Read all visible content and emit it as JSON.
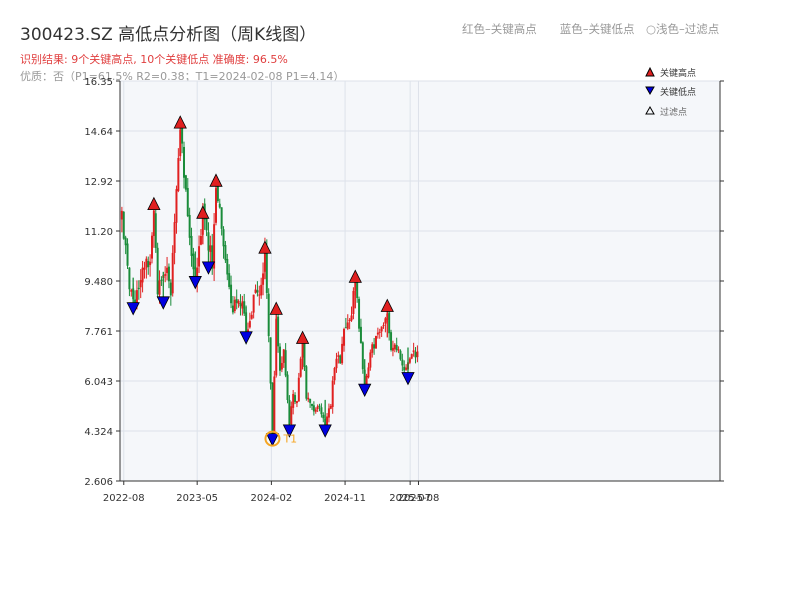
{
  "header": {
    "title": "300423.SZ 高低点分析图（周K线图）",
    "subtitle": "红色–关键高点　　蓝色–关键低点　○浅色–过滤点",
    "stats": "识别结果: 9个关键高点, 10个关键低点  准确度: 96.5%",
    "quality": "优质：否（P1=61.5%  R2=0.38；T1=2024-02-08 P1=4.14）"
  },
  "colors": {
    "up": "#e02020",
    "down": "#1a8c3a",
    "high_marker": "#e02020",
    "low_marker": "#0000e0",
    "t1_marker": "#f5a623",
    "plot_bg": "#f5f7fa",
    "grid": "#dde2ea"
  },
  "chart_data": {
    "type": "candlestick",
    "xlabel": "",
    "ylabel": "",
    "ylim": [
      2.606,
      16.35
    ],
    "y_ticks": [
      "16.35",
      "14.64",
      "12.92",
      "11.20",
      "9.480",
      "7.761",
      "6.043",
      "4.324",
      "2.606"
    ],
    "x_ticks": [
      "2022-08",
      "2023-05",
      "2024-02",
      "2024-11",
      "2025-08",
      "2025-07"
    ],
    "grid": "on",
    "legend": {
      "placement": "top-right",
      "items": [
        {
          "label": "关键高点",
          "marker": "triangle-up-red"
        },
        {
          "label": "关键低点",
          "marker": "triangle-down-blue"
        },
        {
          "label": "过滤点",
          "marker": "triangle-up-hollow"
        }
      ]
    },
    "series_anchors": [
      [
        "2022-07-25",
        11.6
      ],
      [
        "2022-08-22",
        9.2
      ],
      [
        "2022-09-05",
        8.7
      ],
      [
        "2022-10-03",
        9.6
      ],
      [
        "2022-11-07",
        10.4
      ],
      [
        "2022-11-21",
        12.0
      ],
      [
        "2022-12-05",
        9.2
      ],
      [
        "2023-01-09",
        9.9
      ],
      [
        "2023-01-23",
        8.9
      ],
      [
        "2023-02-13",
        12.8
      ],
      [
        "2023-02-27",
        14.8
      ],
      [
        "2023-03-20",
        12.7
      ],
      [
        "2023-04-10",
        10.6
      ],
      [
        "2023-04-24",
        9.6
      ],
      [
        "2023-05-22",
        11.7
      ],
      [
        "2023-06-05",
        11.0
      ],
      [
        "2023-06-26",
        10.1
      ],
      [
        "2023-07-10",
        12.8
      ],
      [
        "2023-07-31",
        11.5
      ],
      [
        "2023-09-04",
        8.6
      ],
      [
        "2023-10-16",
        8.7
      ],
      [
        "2023-10-30",
        7.7
      ],
      [
        "2023-11-27",
        8.8
      ],
      [
        "2023-12-25",
        9.3
      ],
      [
        "2024-01-08",
        10.5
      ],
      [
        "2024-01-22",
        7.5
      ],
      [
        "2024-02-05",
        4.2
      ],
      [
        "2024-02-19",
        8.4
      ],
      [
        "2024-03-04",
        6.5
      ],
      [
        "2024-03-18",
        7.1
      ],
      [
        "2024-04-08",
        4.5
      ],
      [
        "2024-04-22",
        5.6
      ],
      [
        "2024-05-06",
        5.3
      ],
      [
        "2024-05-27",
        7.4
      ],
      [
        "2024-06-10",
        5.4
      ],
      [
        "2024-07-08",
        5.1
      ],
      [
        "2024-07-29",
        5.2
      ],
      [
        "2024-08-19",
        4.5
      ],
      [
        "2024-09-09",
        5.3
      ],
      [
        "2024-09-23",
        6.6
      ],
      [
        "2024-10-14",
        6.8
      ],
      [
        "2024-11-04",
        8.0
      ],
      [
        "2024-11-25",
        8.4
      ],
      [
        "2024-12-09",
        9.5
      ],
      [
        "2024-12-30",
        7.3
      ],
      [
        "2025-01-13",
        5.9
      ],
      [
        "2025-02-03",
        7.1
      ],
      [
        "2025-02-24",
        7.4
      ],
      [
        "2025-03-17",
        8.0
      ],
      [
        "2025-04-07",
        8.5
      ],
      [
        "2025-04-21",
        7.0
      ],
      [
        "2025-05-19",
        7.2
      ],
      [
        "2025-06-09",
        6.3
      ],
      [
        "2025-06-30",
        7.0
      ],
      [
        "2025-07-28",
        6.9
      ]
    ],
    "key_highs": [
      {
        "date": "2022-11-21",
        "value": 12.0
      },
      {
        "date": "2023-02-27",
        "value": 14.8
      },
      {
        "date": "2023-05-22",
        "value": 11.7
      },
      {
        "date": "2023-07-10",
        "value": 12.8
      },
      {
        "date": "2024-01-08",
        "value": 10.5
      },
      {
        "date": "2024-02-19",
        "value": 8.4
      },
      {
        "date": "2024-05-27",
        "value": 7.4
      },
      {
        "date": "2024-12-09",
        "value": 9.5
      },
      {
        "date": "2025-04-07",
        "value": 8.5
      }
    ],
    "key_lows": [
      {
        "date": "2022-09-05",
        "value": 8.7
      },
      {
        "date": "2022-12-26",
        "value": 8.9
      },
      {
        "date": "2023-04-24",
        "value": 9.6
      },
      {
        "date": "2023-06-12",
        "value": 10.1
      },
      {
        "date": "2023-10-30",
        "value": 7.7
      },
      {
        "date": "2024-02-05",
        "value": 4.2
      },
      {
        "date": "2024-04-08",
        "value": 4.5
      },
      {
        "date": "2024-08-19",
        "value": 4.5
      },
      {
        "date": "2025-01-13",
        "value": 5.9
      },
      {
        "date": "2025-06-23",
        "value": 6.3
      }
    ],
    "t1": {
      "label": "T1",
      "date": "2024-02-05",
      "value": 4.2
    }
  }
}
